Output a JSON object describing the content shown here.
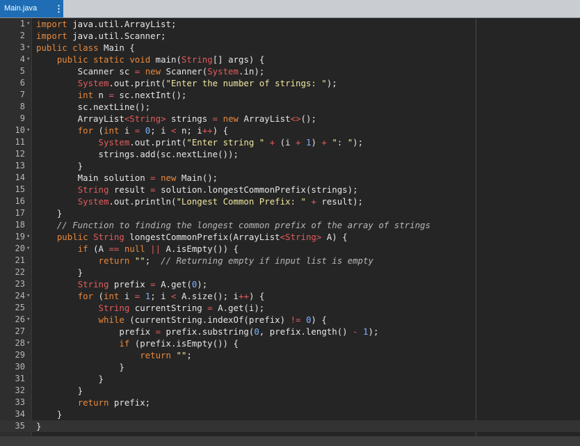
{
  "tab": {
    "title": "Main.java",
    "menu_icon": "kebab-menu-icon"
  },
  "colors": {
    "tab_bg": "#1e6db5",
    "editor_bg": "#252525",
    "keyword": "#e8893c",
    "class": "#e45b5b",
    "string": "#f0e6a0",
    "comment": "#b7b7b7"
  },
  "editor": {
    "active_line": 35,
    "lines": [
      {
        "n": "1",
        "fold": true
      },
      {
        "n": "2",
        "fold": false
      },
      {
        "n": "3",
        "fold": true
      },
      {
        "n": "4",
        "fold": true
      },
      {
        "n": "5",
        "fold": false
      },
      {
        "n": "6",
        "fold": false
      },
      {
        "n": "7",
        "fold": false
      },
      {
        "n": "8",
        "fold": false
      },
      {
        "n": "9",
        "fold": false
      },
      {
        "n": "10",
        "fold": true
      },
      {
        "n": "11",
        "fold": false
      },
      {
        "n": "12",
        "fold": false
      },
      {
        "n": "13",
        "fold": false
      },
      {
        "n": "14",
        "fold": false
      },
      {
        "n": "15",
        "fold": false
      },
      {
        "n": "16",
        "fold": false
      },
      {
        "n": "17",
        "fold": false
      },
      {
        "n": "18",
        "fold": false
      },
      {
        "n": "19",
        "fold": true
      },
      {
        "n": "20",
        "fold": true
      },
      {
        "n": "21",
        "fold": false
      },
      {
        "n": "22",
        "fold": false
      },
      {
        "n": "23",
        "fold": false
      },
      {
        "n": "24",
        "fold": true
      },
      {
        "n": "25",
        "fold": false
      },
      {
        "n": "26",
        "fold": true
      },
      {
        "n": "27",
        "fold": false
      },
      {
        "n": "28",
        "fold": true
      },
      {
        "n": "29",
        "fold": false
      },
      {
        "n": "30",
        "fold": false
      },
      {
        "n": "31",
        "fold": false
      },
      {
        "n": "32",
        "fold": false
      },
      {
        "n": "33",
        "fold": false
      },
      {
        "n": "34",
        "fold": false
      },
      {
        "n": "35",
        "fold": false
      }
    ],
    "code": [
      "import java.util.ArrayList;",
      "import java.util.Scanner;",
      "public class Main {",
      "    public static void main(String[] args) {",
      "        Scanner sc = new Scanner(System.in);",
      "        System.out.print(\"Enter the number of strings: \");",
      "        int n = sc.nextInt();",
      "        sc.nextLine();",
      "        ArrayList<String> strings = new ArrayList<>();",
      "        for (int i = 0; i < n; i++) {",
      "            System.out.print(\"Enter string \" + (i + 1) + \": \");",
      "            strings.add(sc.nextLine());",
      "        }",
      "        Main solution = new Main();",
      "        String result = solution.longestCommonPrefix(strings);",
      "        System.out.println(\"Longest Common Prefix: \" + result);",
      "    }",
      "    // Function to finding the longest common prefix of the array of strings",
      "    public String longestCommonPrefix(ArrayList<String> A) {",
      "        if (A == null || A.isEmpty()) {",
      "            return \"\";  // Returning empty if input list is empty",
      "        }",
      "        String prefix = A.get(0);",
      "        for (int i = 1; i < A.size(); i++) {",
      "            String currentString = A.get(i);",
      "            while (currentString.indexOf(prefix) != 0) {",
      "                prefix = prefix.substring(0, prefix.length() - 1);",
      "                if (prefix.isEmpty()) {",
      "                    return \"\";",
      "                }",
      "            }",
      "        }",
      "        return prefix;",
      "    }",
      "}"
    ]
  }
}
